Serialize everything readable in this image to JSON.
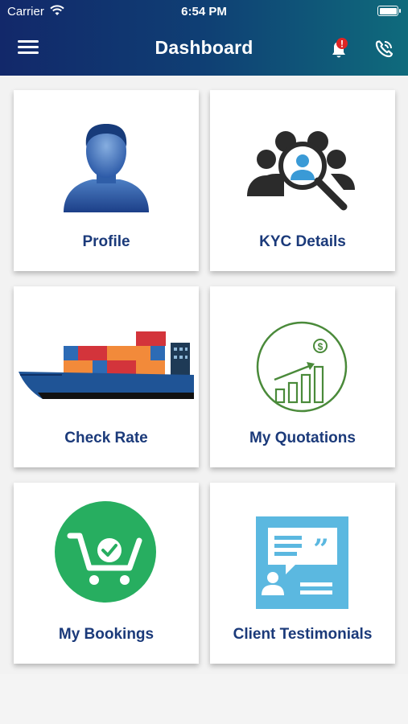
{
  "status_bar": {
    "carrier": "Carrier",
    "time": "6:54 PM"
  },
  "header": {
    "title": "Dashboard",
    "menu_icon": "hamburger-menu-icon",
    "notification_icon": "bell-alert-icon",
    "notification_badge": "!",
    "call_icon": "phone-call-icon",
    "colors": {
      "gradient_start": "#12286a",
      "gradient_end": "#0f6b7c",
      "badge": "#e02424"
    }
  },
  "tiles": [
    {
      "label": "Profile",
      "icon": "user-silhouette-icon"
    },
    {
      "label": "KYC Details",
      "icon": "people-magnifier-icon"
    },
    {
      "label": "Check Rate",
      "icon": "container-ship-icon"
    },
    {
      "label": "My Quotations",
      "icon": "growth-chart-dollar-icon"
    },
    {
      "label": "My Bookings",
      "icon": "cart-check-icon"
    },
    {
      "label": "Client Testimonials",
      "icon": "speech-quote-icon"
    }
  ],
  "colors": {
    "label_text": "#1b3a7a",
    "bookings_green": "#27ae60",
    "testimonials_blue": "#5bb8e0",
    "quotations_green": "#4a8a3a"
  }
}
